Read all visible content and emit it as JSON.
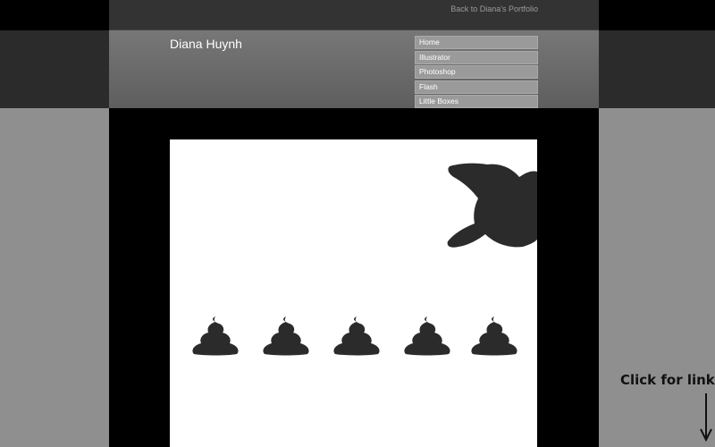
{
  "topbar": {
    "back_link": "Back to Diana's Portfolio"
  },
  "header": {
    "title": "Diana Huynh"
  },
  "nav": {
    "items": [
      "Home",
      "Illustrator",
      "Photoshop",
      "Flash",
      "Little Boxes"
    ]
  },
  "hint": {
    "text": "Click for link"
  },
  "stage": {
    "poop_count": 5,
    "shape_color": "#2b2b2b"
  }
}
